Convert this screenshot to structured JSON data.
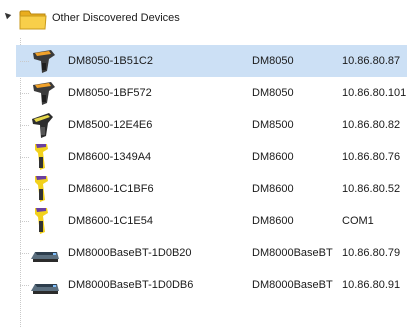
{
  "group": {
    "label": "Other Discovered Devices"
  },
  "colors": {
    "selection": "#cce0f5",
    "folder": "#f5c233",
    "scanner_yellow": "#f2d11c",
    "scanner_body": "#3a3a3a"
  },
  "devices": [
    {
      "name": "DM8050-1B51C2",
      "model": "DM8050",
      "address": "10.86.80.87",
      "icon": "handheld-scanner-orange-icon",
      "selected": true
    },
    {
      "name": "DM8050-1BF572",
      "model": "DM8050",
      "address": "10.86.80.101",
      "icon": "handheld-scanner-orange-icon",
      "selected": false
    },
    {
      "name": "DM8500-12E4E6",
      "model": "DM8500",
      "address": "10.86.80.82",
      "icon": "handheld-scanner-dark-icon",
      "selected": false
    },
    {
      "name": "DM8600-1349A4",
      "model": "DM8600",
      "address": "10.86.80.76",
      "icon": "handheld-scanner-yellow-icon",
      "selected": false
    },
    {
      "name": "DM8600-1C1BF6",
      "model": "DM8600",
      "address": "10.86.80.52",
      "icon": "handheld-scanner-yellow-icon",
      "selected": false
    },
    {
      "name": "DM8600-1C1E54",
      "model": "DM8600",
      "address": "COM1",
      "icon": "handheld-scanner-yellow-icon",
      "selected": false
    },
    {
      "name": "DM8000BaseBT-1D0B20",
      "model": "DM8000BaseBT",
      "address": "10.86.80.79",
      "icon": "base-station-icon",
      "selected": false
    },
    {
      "name": "DM8000BaseBT-1D0DB6",
      "model": "DM8000BaseBT",
      "address": "10.86.80.91",
      "icon": "base-station-icon",
      "selected": false
    }
  ]
}
